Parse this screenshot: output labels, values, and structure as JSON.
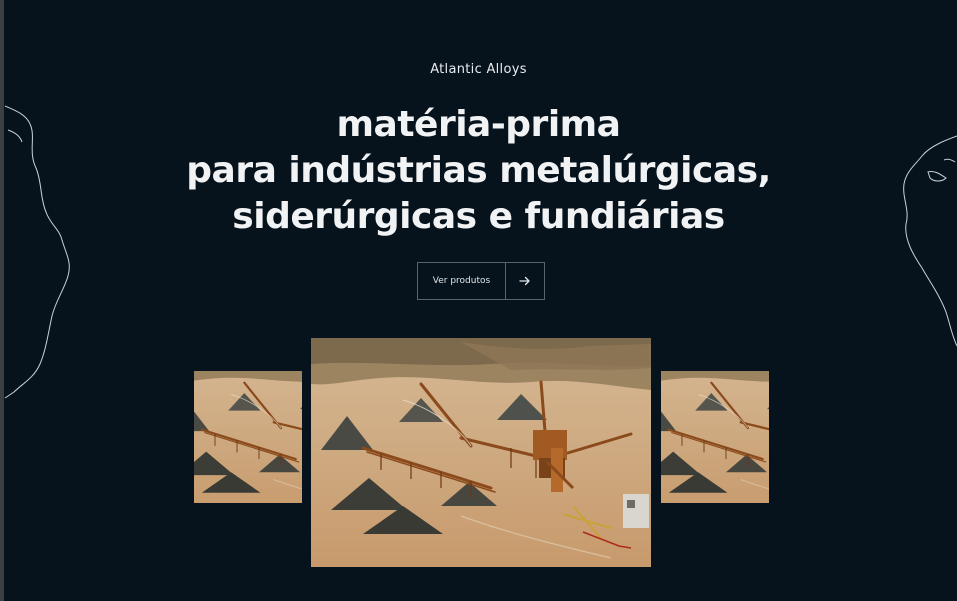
{
  "brand": {
    "name": "Atlantic Alloys"
  },
  "hero": {
    "headline_lines": [
      "matéria-prima",
      "para indústrias metalúrgicas,",
      "siderúrgicas e fundiárias"
    ],
    "cta_label": "Ver produtos",
    "cta_icon": "arrow-right-icon"
  },
  "carousel": {
    "slides": [
      {
        "position": "previous",
        "image": "crushing-plant-photo"
      },
      {
        "position": "current",
        "image": "crushing-plant-photo"
      },
      {
        "position": "next",
        "image": "crushing-plant-photo"
      }
    ]
  },
  "colors": {
    "background": "#07131c",
    "text": "#f0f2f4",
    "border": "#5a636b",
    "outline": "#c9d2d8"
  }
}
